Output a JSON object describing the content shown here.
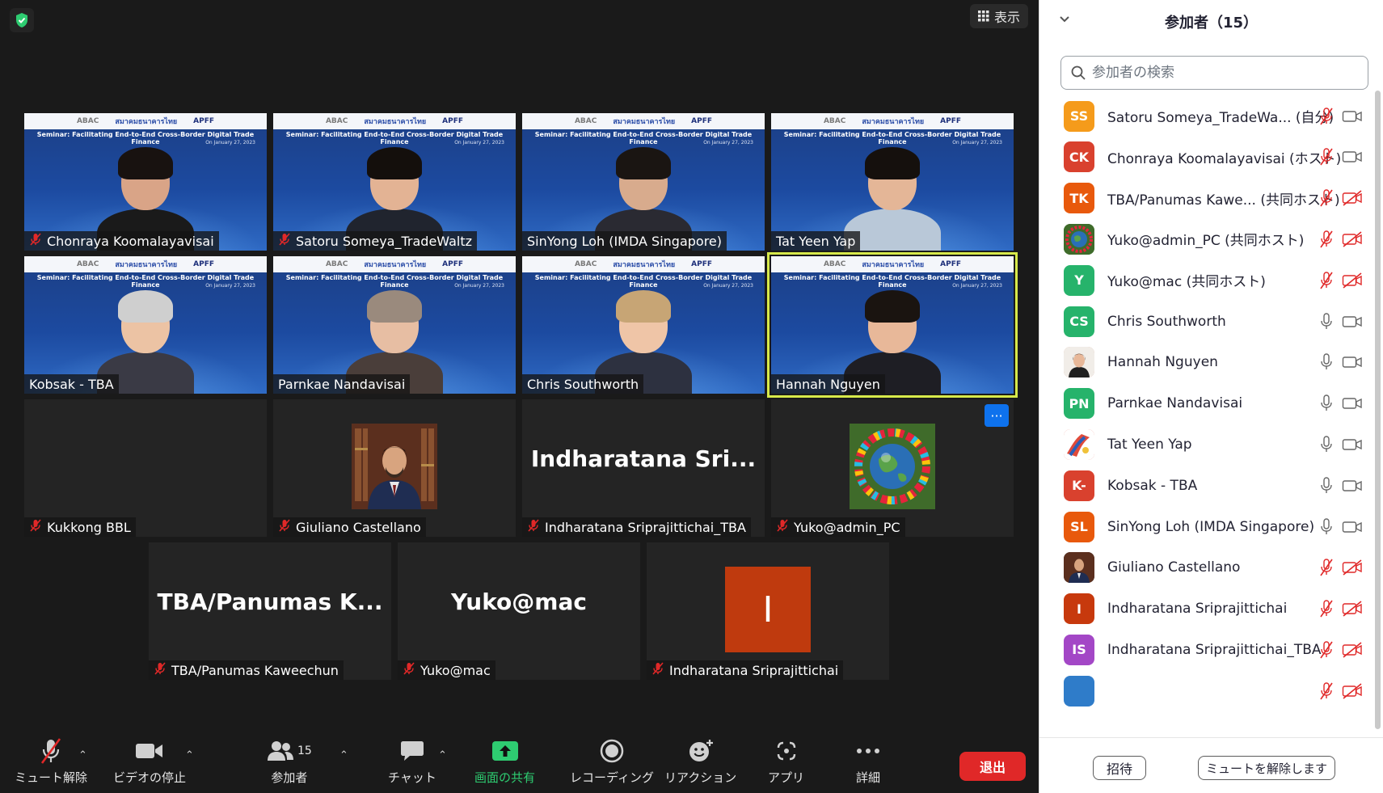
{
  "top": {
    "view_label": "表示"
  },
  "tiles": [
    {
      "name": "Chonraya Koomalayavisai",
      "muted": true
    },
    {
      "name": "Satoru Someya_TradeWaltz",
      "muted": true
    },
    {
      "name": "SinYong Loh (IMDA Singapore)",
      "muted": false
    },
    {
      "name": "Tat Yeen Yap",
      "muted": false
    },
    {
      "name": "Kobsak - TBA",
      "muted": false
    },
    {
      "name": "Parnkae Nandavisai",
      "muted": false
    },
    {
      "name": "Chris Southworth",
      "muted": false
    },
    {
      "name": "Hannah Nguyen",
      "muted": false
    },
    {
      "name": "Kukkong BBL",
      "muted": true
    },
    {
      "name": "Giuliano Castellano",
      "muted": true
    },
    {
      "name": "Indharatana Sriprajittichai_TBA",
      "muted": true,
      "display": "Indharatana  Sri..."
    },
    {
      "name": "Yuko@admin_PC",
      "muted": true
    },
    {
      "name": "TBA/Panumas Kaweechun",
      "muted": true,
      "display": "TBA/Panumas  K..."
    },
    {
      "name": "Yuko@mac",
      "muted": true,
      "display": "Yuko@mac"
    },
    {
      "name": "Indharatana Sriprajittichai",
      "muted": true,
      "initial": "I"
    }
  ],
  "banner": {
    "left": "ABAC",
    "mid": "สมาคมธนาคารไทย",
    "right": "APFF",
    "seminar": "Seminar: Facilitating End-to-End Cross-Border Digital Trade Finance",
    "date": "On January 27, 2023"
  },
  "more_label": "···",
  "toolbar": {
    "unmute": "ミュート解除",
    "stop_video": "ビデオの停止",
    "participants": "参加者",
    "participants_count": "15",
    "chat": "チャット",
    "share": "画面の共有",
    "record": "レコーディング",
    "reactions": "リアクション",
    "apps": "アプリ",
    "more": "詳細",
    "leave": "退出"
  },
  "panel": {
    "title": "参加者（15）",
    "search_placeholder": "参加者の検索",
    "invite": "招待",
    "unmute_me": "ミュートを解除します",
    "participants": [
      {
        "initials": "SS",
        "name": "Satoru Someya_TradeWa... (自分)",
        "color": "#f59b1b",
        "mic": "muted",
        "cam": "on"
      },
      {
        "initials": "CK",
        "name": "Chonraya Koomalayavisai (ホスト)",
        "color": "#d9412e",
        "mic": "muted",
        "cam": "on"
      },
      {
        "initials": "TK",
        "name": "TBA/Panumas Kawe... (共同ホスト)",
        "color": "#e8590c",
        "mic": "muted",
        "cam": "off"
      },
      {
        "initials": "",
        "name": "Yuko@admin_PC (共同ホスト)",
        "color": "#3a7d3a",
        "mic": "muted",
        "cam": "off",
        "picture": "globe"
      },
      {
        "initials": "Y",
        "name": "Yuko@mac (共同ホスト)",
        "color": "#26b36b",
        "mic": "muted",
        "cam": "off"
      },
      {
        "initials": "CS",
        "name": "Chris Southworth",
        "color": "#26b36b",
        "mic": "on",
        "cam": "on"
      },
      {
        "initials": "",
        "name": "Hannah Nguyen",
        "color": "#c98f78",
        "mic": "on",
        "cam": "on",
        "picture": "face"
      },
      {
        "initials": "PN",
        "name": "Parnkae Nandavisai",
        "color": "#26b36b",
        "mic": "on",
        "cam": "on"
      },
      {
        "initials": "",
        "name": "Tat Yeen Yap",
        "color": "#e04a3a",
        "mic": "on",
        "cam": "on",
        "picture": "flag"
      },
      {
        "initials": "K-",
        "name": "Kobsak - TBA",
        "color": "#d9412e",
        "mic": "on",
        "cam": "on"
      },
      {
        "initials": "SL",
        "name": "SinYong Loh (IMDA Singapore)",
        "color": "#e8590c",
        "mic": "on",
        "cam": "on"
      },
      {
        "initials": "",
        "name": "Giuliano Castellano",
        "color": "#3b3b4a",
        "mic": "muted",
        "cam": "off",
        "picture": "suit"
      },
      {
        "initials": "I",
        "name": "Indharatana Sriprajittichai",
        "color": "#c7390d",
        "mic": "muted",
        "cam": "off"
      },
      {
        "initials": "IS",
        "name": "Indharatana Sriprajittichai_TBA",
        "color": "#a347c6",
        "mic": "muted",
        "cam": "off"
      },
      {
        "initials": "",
        "name": "",
        "color": "#2f7cc9",
        "mic": "muted",
        "cam": "off"
      }
    ]
  },
  "colors": {
    "speaking_border": "#d7e94a",
    "leave_button": "#e02828",
    "share_green": "#2ecc71",
    "muted_red": "#e02828"
  }
}
